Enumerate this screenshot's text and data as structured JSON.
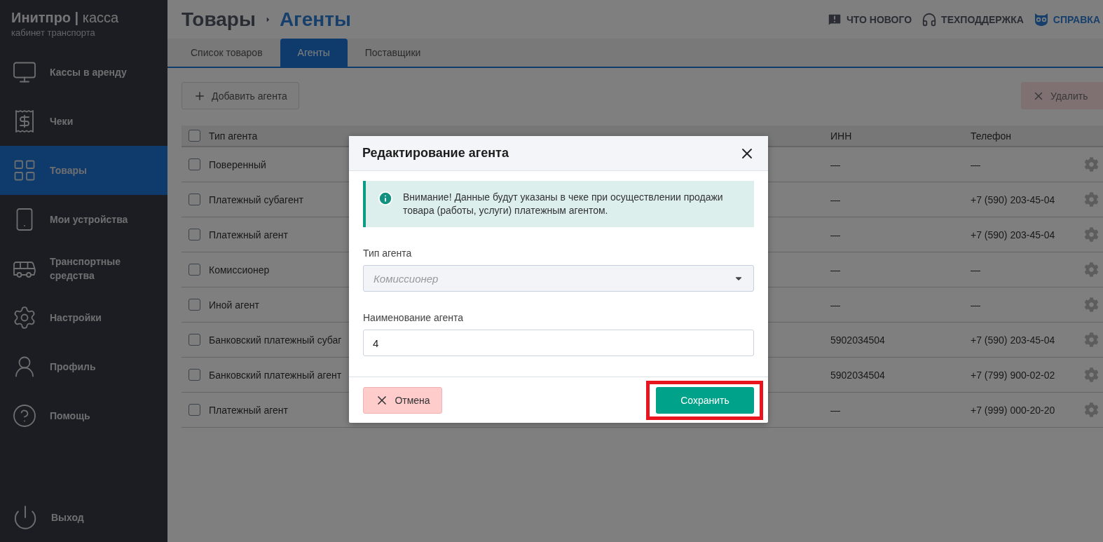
{
  "brand": {
    "name": "**Инитпро |** касса",
    "subtitle": "кабинет транспорта"
  },
  "sidebar": {
    "items": [
      {
        "label": "Кассы в аренду",
        "selected": false
      },
      {
        "label": "Чеки",
        "selected": false
      },
      {
        "label": "Товары",
        "selected": true
      },
      {
        "label": "Мои устройства",
        "selected": false
      },
      {
        "label": "Транспортные средства",
        "selected": false
      },
      {
        "label": "Настройки",
        "selected": false
      },
      {
        "label": "Профиль",
        "selected": false
      },
      {
        "label": "Помощь",
        "selected": false
      }
    ],
    "logout": "Выход"
  },
  "header": {
    "breadcrumb": [
      "Товары",
      "Агенты"
    ],
    "links": [
      "ЧТО НОВОГО",
      "ТЕХПОДДЕРЖКА",
      "СПРАВКА"
    ]
  },
  "tabs": [
    {
      "label": "Список товаров",
      "selected": false
    },
    {
      "label": "Агенты",
      "selected": true
    },
    {
      "label": "Поставщики",
      "selected": false
    }
  ],
  "toolbar": {
    "add_button": "Добавить агента",
    "delete_button": {
      "label": "Удалить",
      "disabled": true
    }
  },
  "table": {
    "header_checked": false,
    "columns": [
      "Тип агента",
      "ИНН",
      "Телефон"
    ],
    "rows": [
      {
        "type": "Поверенный",
        "inn": "—",
        "phone": "—",
        "checked": false
      },
      {
        "type": "Платежный субагент",
        "inn": "—",
        "phone": "+7 (590) 203-45-04",
        "checked": false
      },
      {
        "type": "Платежный агент",
        "inn": "—",
        "phone": "+7 (590) 203-45-04",
        "checked": false
      },
      {
        "type": "Комиссионер",
        "inn": "—",
        "phone": "—",
        "checked": false
      },
      {
        "type": "Иной агент",
        "inn": "—",
        "phone": "—",
        "checked": false
      },
      {
        "type": "Банковский платежный субаг",
        "inn": "5902034504",
        "phone": "+7 (590) 203-45-04",
        "checked": false
      },
      {
        "type": "Банковский платежный агент",
        "inn": "5902034504",
        "phone": "+7 (799) 900-02-02",
        "checked": false
      },
      {
        "type": "Платежный агент",
        "inn": "—",
        "phone": "+7 (999) 000-20-20",
        "checked": false
      }
    ]
  },
  "dialog": {
    "title": "Редактирование агента",
    "notice": "Внимание! Данные будут указаны в чеке при осуществлении продажи товара (работы, услуги) платежным агентом.",
    "fields": [
      {
        "label": "Тип агента",
        "kind": "select",
        "value": "Комиссионер",
        "disabled": true
      },
      {
        "label": "Наименование агента",
        "kind": "text",
        "value": "4",
        "disabled": false
      }
    ],
    "cancel_button": "Отмена",
    "save_button": {
      "label": "Сохранить",
      "highlighted": true
    }
  }
}
